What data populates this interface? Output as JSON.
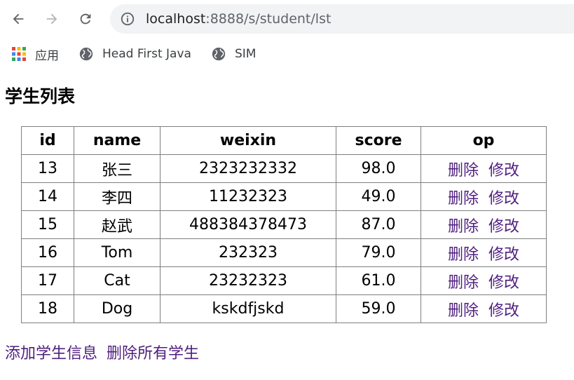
{
  "browser": {
    "url_host": "localhost",
    "url_rest": ":8888/s/student/lst"
  },
  "bookmarks": [
    {
      "label": "应用",
      "icon": "apps-grid-icon"
    },
    {
      "label": "Head First Java",
      "icon": "globe-icon"
    },
    {
      "label": "SIM",
      "icon": "globe-icon"
    }
  ],
  "page": {
    "title": "学生列表"
  },
  "table": {
    "headers": [
      "id",
      "name",
      "weixin",
      "score",
      "op"
    ],
    "rows": [
      {
        "id": "13",
        "name": "张三",
        "weixin": "2323232332",
        "score": "98.0",
        "delete": "删除",
        "edit": "修改"
      },
      {
        "id": "14",
        "name": "李四",
        "weixin": "11232323",
        "score": "49.0",
        "delete": "删除",
        "edit": "修改"
      },
      {
        "id": "15",
        "name": "赵武",
        "weixin": "488384378473",
        "score": "87.0",
        "delete": "删除",
        "edit": "修改"
      },
      {
        "id": "16",
        "name": "Tom",
        "weixin": "232323",
        "score": "79.0",
        "delete": "删除",
        "edit": "修改"
      },
      {
        "id": "17",
        "name": "Cat",
        "weixin": "23232323",
        "score": "61.0",
        "delete": "删除",
        "edit": "修改"
      },
      {
        "id": "18",
        "name": "Dog",
        "weixin": "kskdfjskd",
        "score": "59.0",
        "delete": "删除",
        "edit": "修改"
      }
    ]
  },
  "footer": {
    "add_label": "添加学生信息",
    "delete_all_label": "删除所有学生"
  },
  "colors": {
    "link": "#4f1f7f",
    "border": "#7f7f7f",
    "omnibox": "#f1f3f4"
  }
}
